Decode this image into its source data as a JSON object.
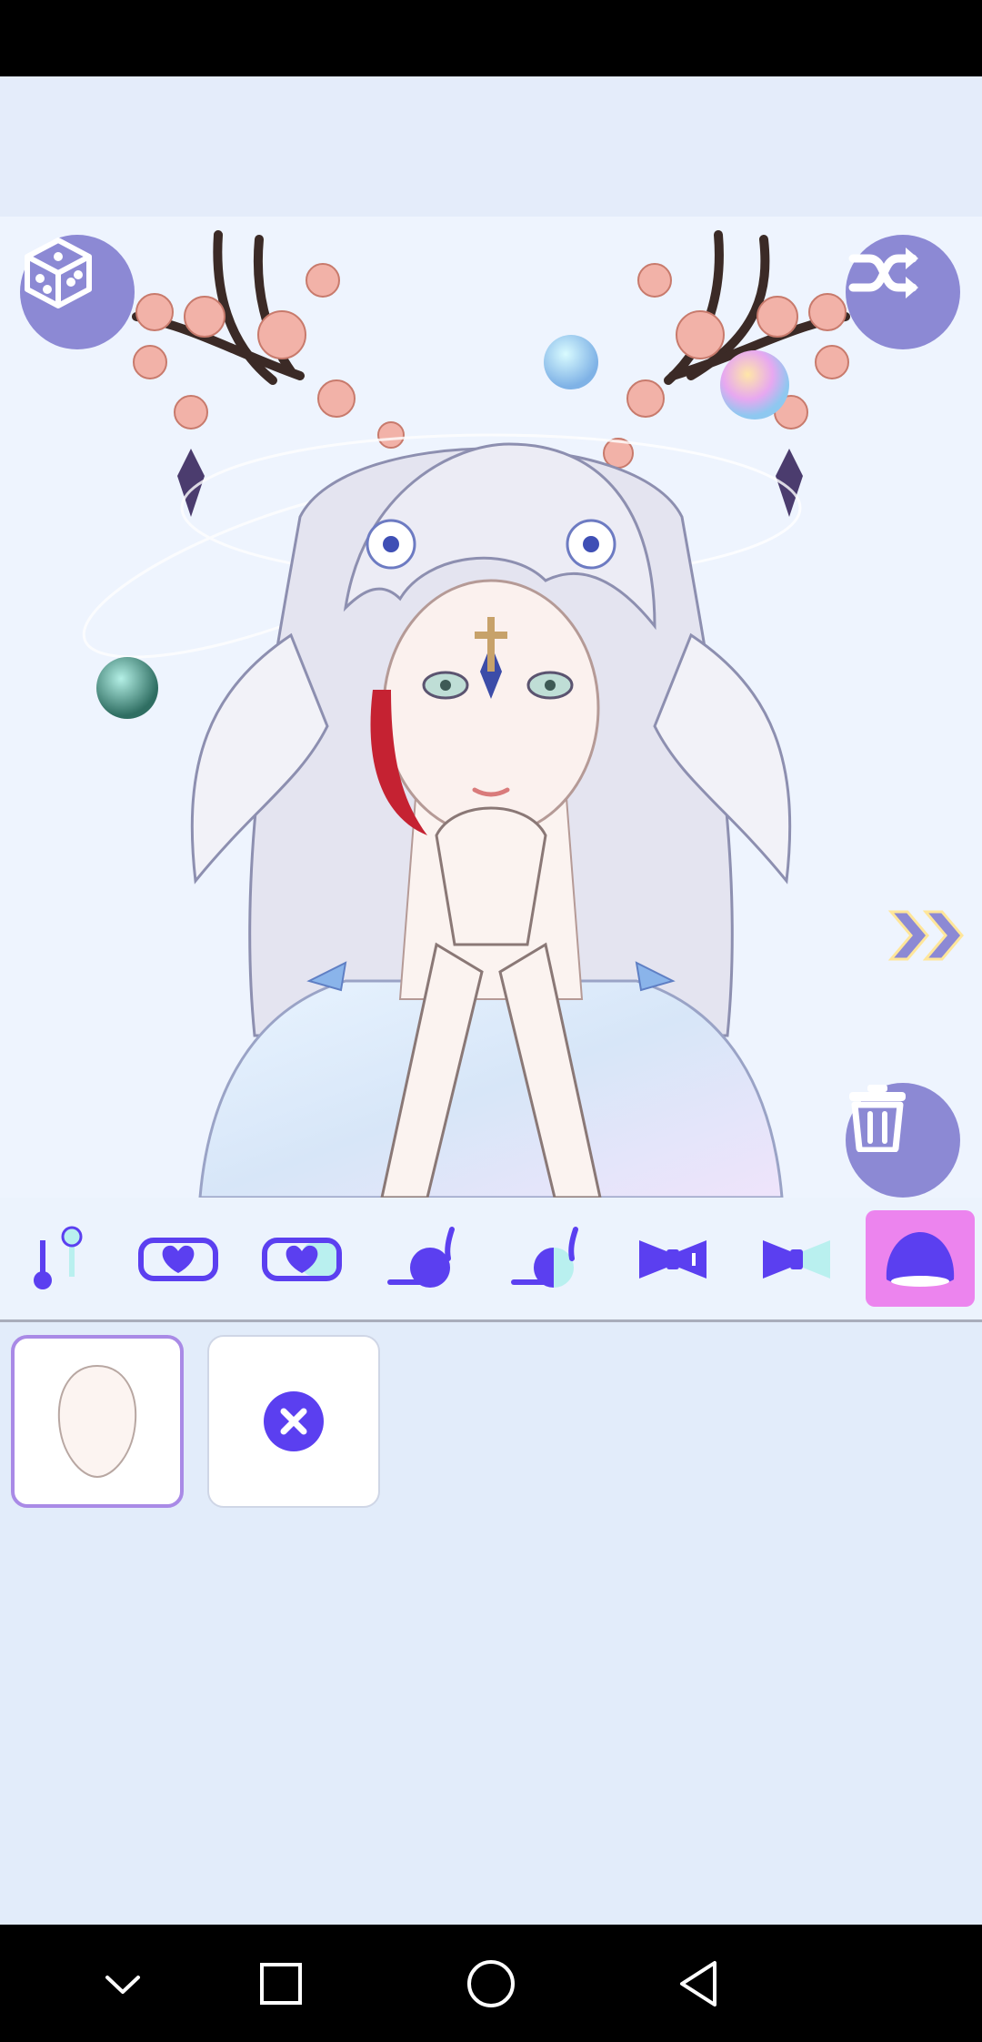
{
  "app": {
    "accent": "#5b3ff0",
    "button_bg": "#8c89d4",
    "active_tab_bg": "#ec84ee"
  },
  "canvas": {
    "background": "#eef4fe",
    "buttons": {
      "random_icon": "dice-icon",
      "shuffle_icon": "shuffle-icon",
      "delete_icon": "trash-icon",
      "next_icon": "double-chevron-right-icon"
    }
  },
  "toolbar": {
    "tabs": [
      {
        "icon": "adjust-position-icon",
        "active": false
      },
      {
        "icon": "heart-frame-icon",
        "active": false
      },
      {
        "icon": "heart-frame-color-icon",
        "active": false
      },
      {
        "icon": "ball-brush-icon",
        "active": false
      },
      {
        "icon": "ball-brush-color-icon",
        "active": false
      },
      {
        "icon": "bow-icon",
        "active": false
      },
      {
        "icon": "bow-color-icon",
        "active": false
      },
      {
        "icon": "blob-shape-icon",
        "active": true
      }
    ]
  },
  "options": {
    "items": [
      {
        "icon": "face-shape-icon",
        "selected": true
      },
      {
        "icon": "remove-icon",
        "selected": false
      }
    ]
  },
  "nav": {
    "items": [
      "collapse-icon",
      "recents-icon",
      "home-icon",
      "back-icon"
    ]
  }
}
